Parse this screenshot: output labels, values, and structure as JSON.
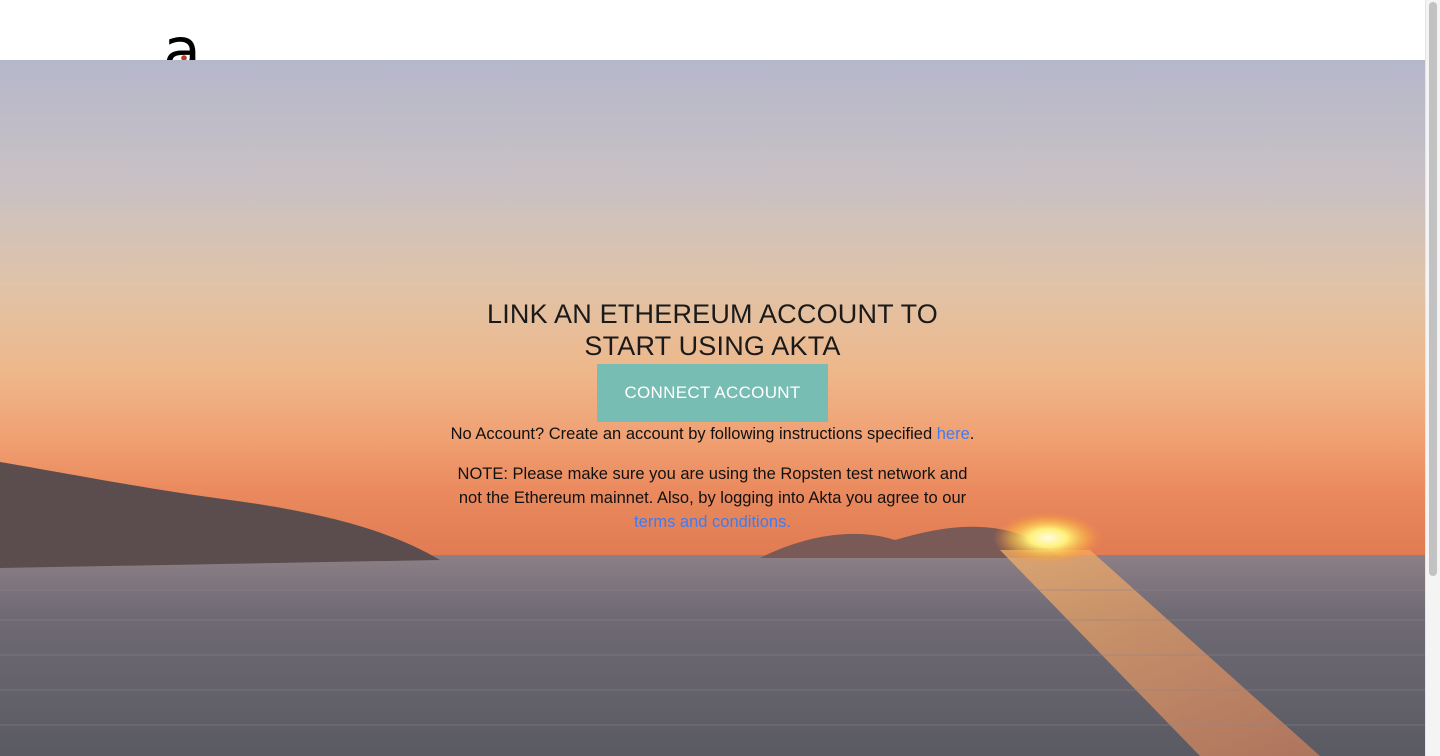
{
  "header": {
    "logo_letter": "a"
  },
  "main": {
    "headline": "LINK AN ETHEREUM ACCOUNT TO START USING AKTA",
    "connect_button": "CONNECT ACCOUNT",
    "no_account_prefix": "No Account? Create an account by following instructions specified ",
    "no_account_link": "here",
    "no_account_suffix": ".",
    "note_prefix": "NOTE: Please make sure you are using the Ropsten test network and not the Ethereum mainnet. Also, by logging into Akta you agree to our ",
    "note_link": "terms and conditions."
  },
  "colors": {
    "accent": "#77bdb3",
    "link": "#3d7cf2"
  }
}
